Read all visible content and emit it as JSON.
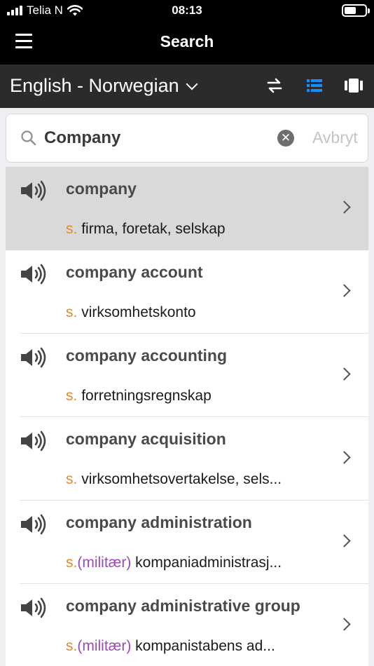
{
  "status": {
    "carrier": "Telia N",
    "time": "08:13"
  },
  "nav": {
    "title": "Search",
    "menu_icon": "hamburger-icon"
  },
  "language_bar": {
    "selected_language": "English - Norwegian",
    "swap_icon": "swap-arrows-icon",
    "list_view_icon": "list-view-icon",
    "card_view_icon": "card-view-icon",
    "active_color": "#1a8cff"
  },
  "search": {
    "query": "Company",
    "cancel_label": "Avbryt",
    "search_icon": "search-icon"
  },
  "colors": {
    "pos": "#e08a2b",
    "domain": "#9b49b5",
    "selected_row": "#d9d9d9"
  },
  "results": [
    {
      "term": "company",
      "pos": "s.",
      "domain": "",
      "translation": "firma, foretak, selskap",
      "selected": true
    },
    {
      "term": "company account",
      "pos": "s.",
      "domain": "",
      "translation": "virksomhetskonto",
      "selected": false
    },
    {
      "term": "company accounting",
      "pos": "s.",
      "domain": "",
      "translation": "forretningsregnskap",
      "selected": false
    },
    {
      "term": "company acquisition",
      "pos": "s.",
      "domain": "",
      "translation": "virksomhetsovertakelse, sels...",
      "selected": false
    },
    {
      "term": "company administration",
      "pos": "s.",
      "domain": "(militær)",
      "translation": "kompaniadministrasj...",
      "selected": false
    },
    {
      "term": "company administrative group",
      "pos": "s.",
      "domain": "(militær)",
      "translation": "kompanistabens ad...",
      "selected": false
    }
  ]
}
